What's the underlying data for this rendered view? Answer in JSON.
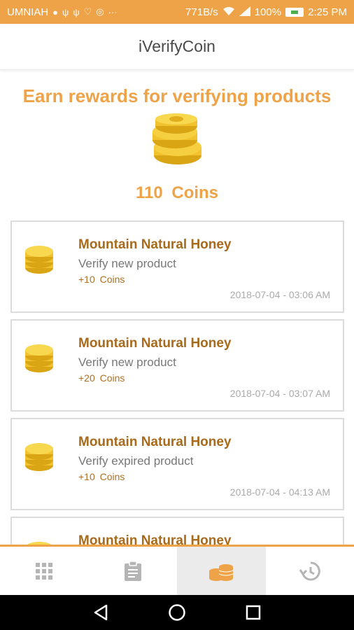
{
  "status_bar": {
    "carrier": "UMNIAH",
    "speed": "771B/s",
    "battery": "100%",
    "time": "2:25 PM"
  },
  "app": {
    "title": "iVerifyCoin"
  },
  "hero": {
    "title": "Earn rewards for verifying products",
    "coins_amount": "110",
    "coins_label": "Coins"
  },
  "activities": [
    {
      "title": "Mountain Natural Honey",
      "subtitle": "Verify new product",
      "reward": "+10  Coins",
      "time": "2018-07-04 - 03:06 AM"
    },
    {
      "title": "Mountain Natural Honey",
      "subtitle": "Verify new product",
      "reward": "+20  Coins",
      "time": "2018-07-04 - 03:07 AM"
    },
    {
      "title": "Mountain Natural Honey",
      "subtitle": "Verify expired product",
      "reward": "+10  Coins",
      "time": "2018-07-04 - 04:13 AM"
    },
    {
      "title": "Mountain Natural Honey"
    }
  ],
  "tabs": [
    {
      "icon": "grid-icon",
      "active": false
    },
    {
      "icon": "clipboard-icon",
      "active": false
    },
    {
      "icon": "coins-icon",
      "active": true
    },
    {
      "icon": "history-icon",
      "active": false
    }
  ],
  "colors": {
    "accent": "#efa348",
    "title_brown": "#a86a1c",
    "coin_gold": "#f2c12e"
  }
}
